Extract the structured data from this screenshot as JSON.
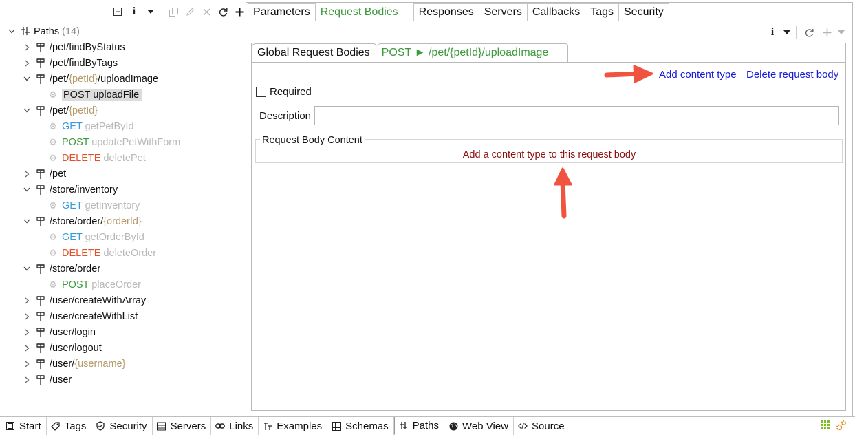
{
  "tree": {
    "root": {
      "label": "Paths",
      "count": "(14)"
    },
    "rows": [
      {
        "kind": "path",
        "parts": [
          {
            "t": "/pet/findByStatus",
            "c": ""
          }
        ],
        "expanded": false
      },
      {
        "kind": "path",
        "parts": [
          {
            "t": "/pet/findByTags",
            "c": ""
          }
        ],
        "expanded": false
      },
      {
        "kind": "path",
        "parts": [
          {
            "t": "/pet/",
            "c": ""
          },
          {
            "t": "{petId}",
            "c": "param"
          },
          {
            "t": "/uploadImage",
            "c": ""
          }
        ],
        "expanded": true
      },
      {
        "kind": "op",
        "method": "POST",
        "name": "uploadFile",
        "selected": true
      },
      {
        "kind": "path",
        "parts": [
          {
            "t": "/pet/",
            "c": ""
          },
          {
            "t": "{petId}",
            "c": "param"
          }
        ],
        "expanded": true
      },
      {
        "kind": "op",
        "method": "GET",
        "name": "getPetById"
      },
      {
        "kind": "op",
        "method": "POST",
        "name": "updatePetWithForm"
      },
      {
        "kind": "op",
        "method": "DELETE",
        "name": "deletePet"
      },
      {
        "kind": "path",
        "parts": [
          {
            "t": "/pet",
            "c": ""
          }
        ],
        "expanded": false
      },
      {
        "kind": "path",
        "parts": [
          {
            "t": "/store/inventory",
            "c": ""
          }
        ],
        "expanded": true
      },
      {
        "kind": "op",
        "method": "GET",
        "name": "getInventory"
      },
      {
        "kind": "path",
        "parts": [
          {
            "t": "/store/order/",
            "c": ""
          },
          {
            "t": "{orderId}",
            "c": "param"
          }
        ],
        "expanded": true
      },
      {
        "kind": "op",
        "method": "GET",
        "name": "getOrderById"
      },
      {
        "kind": "op",
        "method": "DELETE",
        "name": "deleteOrder"
      },
      {
        "kind": "path",
        "parts": [
          {
            "t": "/store/order",
            "c": ""
          }
        ],
        "expanded": true
      },
      {
        "kind": "op",
        "method": "POST",
        "name": "placeOrder"
      },
      {
        "kind": "path",
        "parts": [
          {
            "t": "/user/createWithArray",
            "c": ""
          }
        ],
        "expanded": false
      },
      {
        "kind": "path",
        "parts": [
          {
            "t": "/user/createWithList",
            "c": ""
          }
        ],
        "expanded": false
      },
      {
        "kind": "path",
        "parts": [
          {
            "t": "/user/login",
            "c": ""
          }
        ],
        "expanded": false
      },
      {
        "kind": "path",
        "parts": [
          {
            "t": "/user/logout",
            "c": ""
          }
        ],
        "expanded": false
      },
      {
        "kind": "path",
        "parts": [
          {
            "t": "/user/",
            "c": ""
          },
          {
            "t": "{username}",
            "c": "param"
          }
        ],
        "expanded": false
      },
      {
        "kind": "path",
        "parts": [
          {
            "t": "/user",
            "c": ""
          }
        ],
        "expanded": false
      }
    ],
    "toolbar_icons": [
      "collapse-all-icon",
      "info-icon",
      "dropdown-icon",
      "copy-icon",
      "edit-icon",
      "delete-icon",
      "refresh-icon",
      "add-icon"
    ]
  },
  "top_tabs": [
    {
      "label": "Parameters",
      "active": false
    },
    {
      "label": "Request Bodies",
      "active": true
    },
    {
      "label": "Responses",
      "active": false
    },
    {
      "label": "Servers",
      "active": false
    },
    {
      "label": "Callbacks",
      "active": false
    },
    {
      "label": "Tags",
      "active": false
    },
    {
      "label": "Security",
      "active": false
    }
  ],
  "inner_tabs": {
    "global": "Global Request Bodies",
    "active_method": "POST",
    "active_arrow": "►",
    "active_path": "/pet/{petId}/uploadImage"
  },
  "actions": {
    "add_content_type": "Add content type",
    "delete_request_body": "Delete request body"
  },
  "form": {
    "required_label": "Required",
    "required_checked": false,
    "description_label": "Description",
    "description_value": "",
    "content_group_label": "Request Body Content",
    "content_empty_message": "Add a content type to this request body"
  },
  "bottom_tabs": [
    {
      "label": "Start",
      "icon": "start-icon",
      "active": false
    },
    {
      "label": "Tags",
      "icon": "tag-icon",
      "active": false
    },
    {
      "label": "Security",
      "icon": "shield-icon",
      "active": false
    },
    {
      "label": "Servers",
      "icon": "server-icon",
      "active": false
    },
    {
      "label": "Links",
      "icon": "link-icon",
      "active": false
    },
    {
      "label": "Examples",
      "icon": "examples-icon",
      "active": false
    },
    {
      "label": "Schemas",
      "icon": "schemas-icon",
      "active": false
    },
    {
      "label": "Paths",
      "icon": "paths-icon",
      "active": true
    },
    {
      "label": "Web View",
      "icon": "globe-icon",
      "active": false
    },
    {
      "label": "Source",
      "icon": "code-icon",
      "active": false
    }
  ],
  "colors": {
    "get": "#3a9bd8",
    "post": "#3c9a3c",
    "delete": "#e0522b",
    "param": "#b59a6a",
    "link": "#1a1ad8",
    "empty_message": "#8b1111",
    "annotation_arrow": "#f0533f"
  }
}
